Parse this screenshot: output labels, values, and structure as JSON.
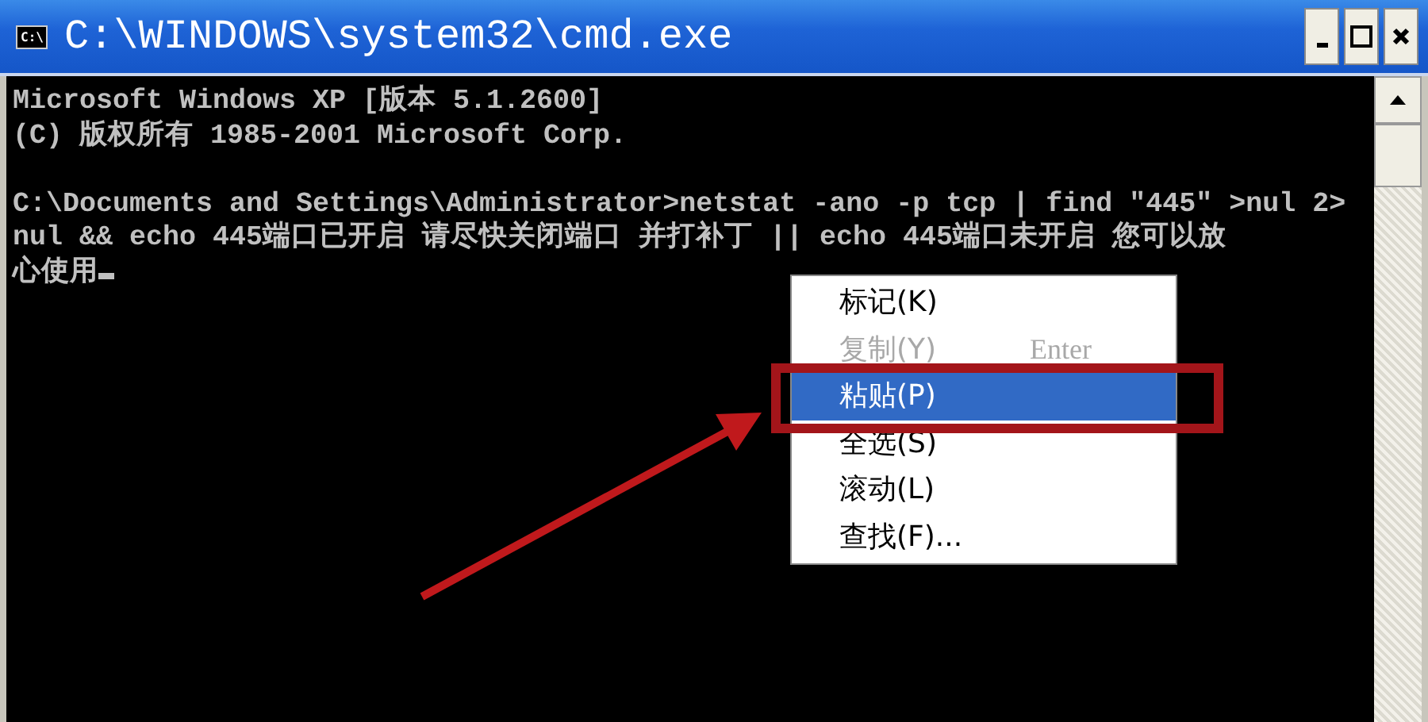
{
  "window": {
    "title": "C:\\WINDOWS\\system32\\cmd.exe",
    "icon_text": "C:\\"
  },
  "console": {
    "lines": [
      "Microsoft Windows XP [版本 5.1.2600]",
      "(C) 版权所有 1985-2001 Microsoft Corp."
    ],
    "command_lines": [
      "C:\\Documents and Settings\\Administrator>netstat -ano -p tcp | find \"445\" >nul 2>",
      "nul && echo 445端口已开启 请尽快关闭端口 并打补丁 || echo 445端口未开启 您可以放",
      "心使用"
    ],
    "cursor": true
  },
  "context_menu": {
    "items": [
      {
        "label": "标记(K)",
        "disabled": false,
        "selected": false
      },
      {
        "label": "复制(Y)",
        "shortcut": "Enter",
        "disabled": true,
        "selected": false
      },
      {
        "label": "粘贴(P)",
        "disabled": false,
        "selected": true
      },
      {
        "label": "全选(S)",
        "disabled": false,
        "selected": false
      },
      {
        "label": "滚动(L)",
        "disabled": false,
        "selected": false
      },
      {
        "label": "查找(F)...",
        "disabled": false,
        "selected": false
      }
    ]
  }
}
